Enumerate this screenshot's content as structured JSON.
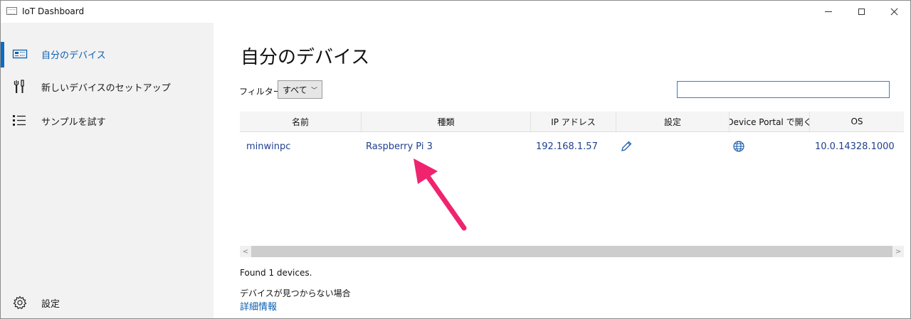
{
  "window": {
    "title": "IoT Dashboard"
  },
  "sidebar": {
    "items": [
      {
        "label": "自分のデバイス",
        "icon": "device-board-icon",
        "selected": true
      },
      {
        "label": "新しいデバイスのセットアップ",
        "icon": "tools-icon",
        "selected": false
      },
      {
        "label": "サンプルを試す",
        "icon": "list-icon",
        "selected": false
      }
    ],
    "settings_label": "設定"
  },
  "main": {
    "page_title": "自分のデバイス",
    "filter_label": "フィルター",
    "filter_value": "すべて",
    "search_value": ""
  },
  "table": {
    "columns": [
      "名前",
      "種類",
      "IP アドレス",
      "設定",
      "Device Portal で開く",
      "OS"
    ],
    "rows": [
      {
        "name": "minwinpc",
        "type": "Raspberry Pi 3",
        "ip": "192.168.1.57",
        "settings_icon": "pencil-icon",
        "portal_icon": "globe-icon",
        "os": "10.0.14328.1000"
      }
    ]
  },
  "status_text": "Found 1 devices.",
  "help": {
    "question": "デバイスが見つからない場合",
    "link": "詳細情報"
  },
  "colors": {
    "accent": "#0a6cc4",
    "annotation_arrow": "#f0236f"
  }
}
